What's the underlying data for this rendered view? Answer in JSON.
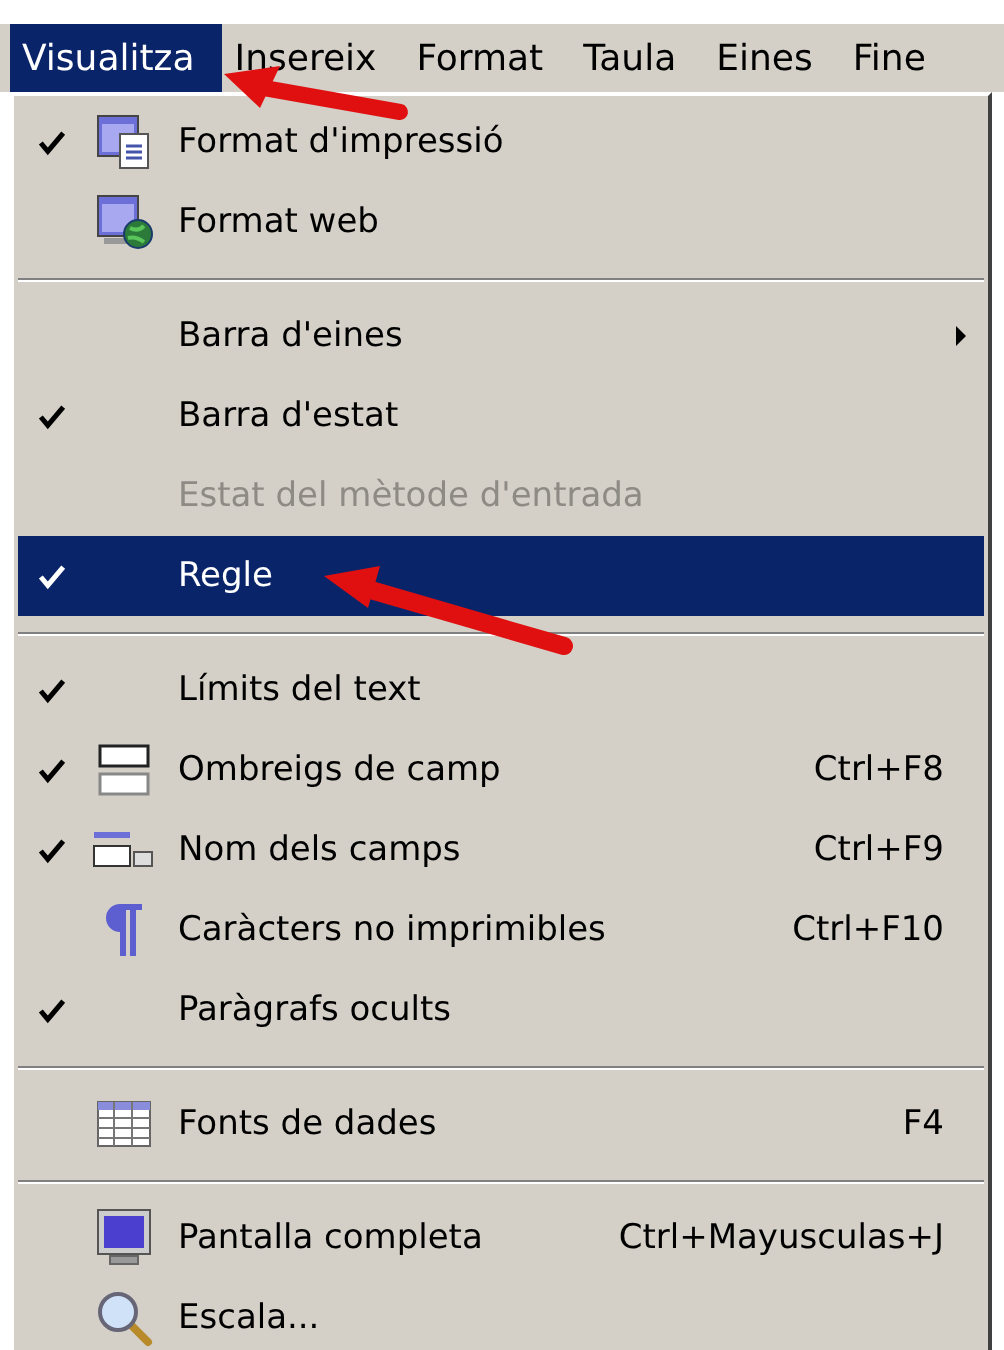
{
  "menubar": [
    {
      "label": "Visualitza",
      "selected": true
    },
    {
      "label": "Insereix",
      "selected": false
    },
    {
      "label": "Format",
      "selected": false
    },
    {
      "label": "Taula",
      "selected": false
    },
    {
      "label": "Eines",
      "selected": false
    },
    {
      "label": "Fine",
      "selected": false
    }
  ],
  "menu": [
    {
      "kind": "item",
      "label": "Format d'impressió",
      "checked": true,
      "disabled": false,
      "selected": false
    },
    {
      "kind": "item",
      "label": "Format web",
      "checked": false,
      "disabled": false,
      "selected": false
    },
    {
      "kind": "separator"
    },
    {
      "kind": "item",
      "label": "Barra d'eines",
      "checked": false,
      "disabled": false,
      "selected": false,
      "submenu": true
    },
    {
      "kind": "item",
      "label": "Barra d'estat",
      "checked": true,
      "disabled": false,
      "selected": false
    },
    {
      "kind": "item",
      "label": "Estat del mètode d'entrada",
      "checked": false,
      "disabled": true,
      "selected": false
    },
    {
      "kind": "item",
      "label": "Regle",
      "checked": true,
      "disabled": false,
      "selected": true
    },
    {
      "kind": "separator"
    },
    {
      "kind": "item",
      "label": "Límits del text",
      "checked": true,
      "disabled": false,
      "selected": false
    },
    {
      "kind": "item",
      "label": "Ombreigs de camp",
      "shortcut": "Ctrl+F8",
      "checked": true,
      "disabled": false,
      "selected": false
    },
    {
      "kind": "item",
      "label": "Nom dels camps",
      "shortcut": "Ctrl+F9",
      "checked": true,
      "disabled": false,
      "selected": false
    },
    {
      "kind": "item",
      "label": "Caràcters no imprimibles",
      "shortcut": "Ctrl+F10",
      "checked": false,
      "disabled": false,
      "selected": false
    },
    {
      "kind": "item",
      "label": "Paràgrafs ocults",
      "checked": true,
      "disabled": false,
      "selected": false
    },
    {
      "kind": "separator"
    },
    {
      "kind": "item",
      "label": "Fonts de dades",
      "shortcut": "F4",
      "checked": false,
      "disabled": false,
      "selected": false
    },
    {
      "kind": "separator"
    },
    {
      "kind": "item",
      "label": "Pantalla completa",
      "shortcut": "Ctrl+Mayusculas+J",
      "checked": false,
      "disabled": false,
      "selected": false
    },
    {
      "kind": "item",
      "label": "Escala...",
      "checked": false,
      "disabled": false,
      "selected": false
    }
  ]
}
